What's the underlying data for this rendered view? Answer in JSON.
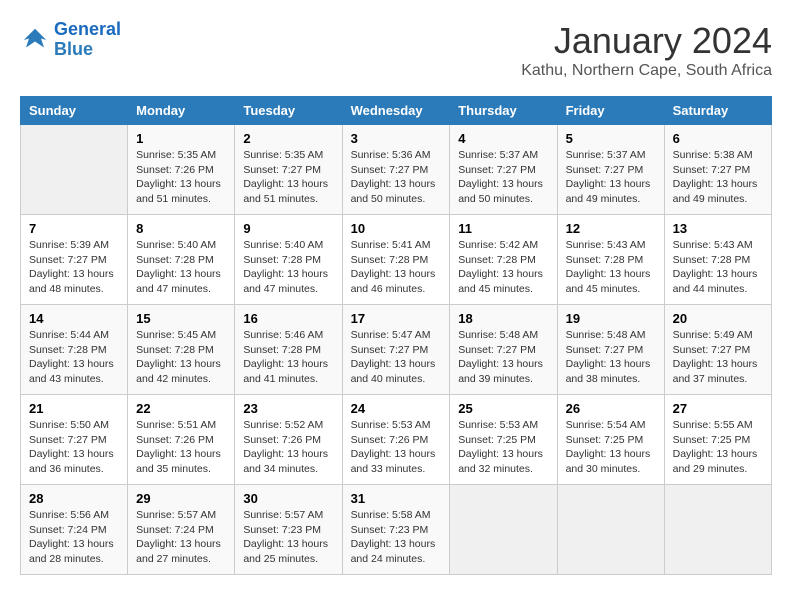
{
  "header": {
    "logo_line1": "General",
    "logo_line2": "Blue",
    "month": "January 2024",
    "location": "Kathu, Northern Cape, South Africa"
  },
  "columns": [
    "Sunday",
    "Monday",
    "Tuesday",
    "Wednesday",
    "Thursday",
    "Friday",
    "Saturday"
  ],
  "weeks": [
    [
      {
        "day": "",
        "sunrise": "",
        "sunset": "",
        "daylight": ""
      },
      {
        "day": "1",
        "sunrise": "Sunrise: 5:35 AM",
        "sunset": "Sunset: 7:26 PM",
        "daylight": "Daylight: 13 hours and 51 minutes."
      },
      {
        "day": "2",
        "sunrise": "Sunrise: 5:35 AM",
        "sunset": "Sunset: 7:27 PM",
        "daylight": "Daylight: 13 hours and 51 minutes."
      },
      {
        "day": "3",
        "sunrise": "Sunrise: 5:36 AM",
        "sunset": "Sunset: 7:27 PM",
        "daylight": "Daylight: 13 hours and 50 minutes."
      },
      {
        "day": "4",
        "sunrise": "Sunrise: 5:37 AM",
        "sunset": "Sunset: 7:27 PM",
        "daylight": "Daylight: 13 hours and 50 minutes."
      },
      {
        "day": "5",
        "sunrise": "Sunrise: 5:37 AM",
        "sunset": "Sunset: 7:27 PM",
        "daylight": "Daylight: 13 hours and 49 minutes."
      },
      {
        "day": "6",
        "sunrise": "Sunrise: 5:38 AM",
        "sunset": "Sunset: 7:27 PM",
        "daylight": "Daylight: 13 hours and 49 minutes."
      }
    ],
    [
      {
        "day": "7",
        "sunrise": "Sunrise: 5:39 AM",
        "sunset": "Sunset: 7:27 PM",
        "daylight": "Daylight: 13 hours and 48 minutes."
      },
      {
        "day": "8",
        "sunrise": "Sunrise: 5:40 AM",
        "sunset": "Sunset: 7:28 PM",
        "daylight": "Daylight: 13 hours and 47 minutes."
      },
      {
        "day": "9",
        "sunrise": "Sunrise: 5:40 AM",
        "sunset": "Sunset: 7:28 PM",
        "daylight": "Daylight: 13 hours and 47 minutes."
      },
      {
        "day": "10",
        "sunrise": "Sunrise: 5:41 AM",
        "sunset": "Sunset: 7:28 PM",
        "daylight": "Daylight: 13 hours and 46 minutes."
      },
      {
        "day": "11",
        "sunrise": "Sunrise: 5:42 AM",
        "sunset": "Sunset: 7:28 PM",
        "daylight": "Daylight: 13 hours and 45 minutes."
      },
      {
        "day": "12",
        "sunrise": "Sunrise: 5:43 AM",
        "sunset": "Sunset: 7:28 PM",
        "daylight": "Daylight: 13 hours and 45 minutes."
      },
      {
        "day": "13",
        "sunrise": "Sunrise: 5:43 AM",
        "sunset": "Sunset: 7:28 PM",
        "daylight": "Daylight: 13 hours and 44 minutes."
      }
    ],
    [
      {
        "day": "14",
        "sunrise": "Sunrise: 5:44 AM",
        "sunset": "Sunset: 7:28 PM",
        "daylight": "Daylight: 13 hours and 43 minutes."
      },
      {
        "day": "15",
        "sunrise": "Sunrise: 5:45 AM",
        "sunset": "Sunset: 7:28 PM",
        "daylight": "Daylight: 13 hours and 42 minutes."
      },
      {
        "day": "16",
        "sunrise": "Sunrise: 5:46 AM",
        "sunset": "Sunset: 7:28 PM",
        "daylight": "Daylight: 13 hours and 41 minutes."
      },
      {
        "day": "17",
        "sunrise": "Sunrise: 5:47 AM",
        "sunset": "Sunset: 7:27 PM",
        "daylight": "Daylight: 13 hours and 40 minutes."
      },
      {
        "day": "18",
        "sunrise": "Sunrise: 5:48 AM",
        "sunset": "Sunset: 7:27 PM",
        "daylight": "Daylight: 13 hours and 39 minutes."
      },
      {
        "day": "19",
        "sunrise": "Sunrise: 5:48 AM",
        "sunset": "Sunset: 7:27 PM",
        "daylight": "Daylight: 13 hours and 38 minutes."
      },
      {
        "day": "20",
        "sunrise": "Sunrise: 5:49 AM",
        "sunset": "Sunset: 7:27 PM",
        "daylight": "Daylight: 13 hours and 37 minutes."
      }
    ],
    [
      {
        "day": "21",
        "sunrise": "Sunrise: 5:50 AM",
        "sunset": "Sunset: 7:27 PM",
        "daylight": "Daylight: 13 hours and 36 minutes."
      },
      {
        "day": "22",
        "sunrise": "Sunrise: 5:51 AM",
        "sunset": "Sunset: 7:26 PM",
        "daylight": "Daylight: 13 hours and 35 minutes."
      },
      {
        "day": "23",
        "sunrise": "Sunrise: 5:52 AM",
        "sunset": "Sunset: 7:26 PM",
        "daylight": "Daylight: 13 hours and 34 minutes."
      },
      {
        "day": "24",
        "sunrise": "Sunrise: 5:53 AM",
        "sunset": "Sunset: 7:26 PM",
        "daylight": "Daylight: 13 hours and 33 minutes."
      },
      {
        "day": "25",
        "sunrise": "Sunrise: 5:53 AM",
        "sunset": "Sunset: 7:25 PM",
        "daylight": "Daylight: 13 hours and 32 minutes."
      },
      {
        "day": "26",
        "sunrise": "Sunrise: 5:54 AM",
        "sunset": "Sunset: 7:25 PM",
        "daylight": "Daylight: 13 hours and 30 minutes."
      },
      {
        "day": "27",
        "sunrise": "Sunrise: 5:55 AM",
        "sunset": "Sunset: 7:25 PM",
        "daylight": "Daylight: 13 hours and 29 minutes."
      }
    ],
    [
      {
        "day": "28",
        "sunrise": "Sunrise: 5:56 AM",
        "sunset": "Sunset: 7:24 PM",
        "daylight": "Daylight: 13 hours and 28 minutes."
      },
      {
        "day": "29",
        "sunrise": "Sunrise: 5:57 AM",
        "sunset": "Sunset: 7:24 PM",
        "daylight": "Daylight: 13 hours and 27 minutes."
      },
      {
        "day": "30",
        "sunrise": "Sunrise: 5:57 AM",
        "sunset": "Sunset: 7:23 PM",
        "daylight": "Daylight: 13 hours and 25 minutes."
      },
      {
        "day": "31",
        "sunrise": "Sunrise: 5:58 AM",
        "sunset": "Sunset: 7:23 PM",
        "daylight": "Daylight: 13 hours and 24 minutes."
      },
      {
        "day": "",
        "sunrise": "",
        "sunset": "",
        "daylight": ""
      },
      {
        "day": "",
        "sunrise": "",
        "sunset": "",
        "daylight": ""
      },
      {
        "day": "",
        "sunrise": "",
        "sunset": "",
        "daylight": ""
      }
    ]
  ]
}
